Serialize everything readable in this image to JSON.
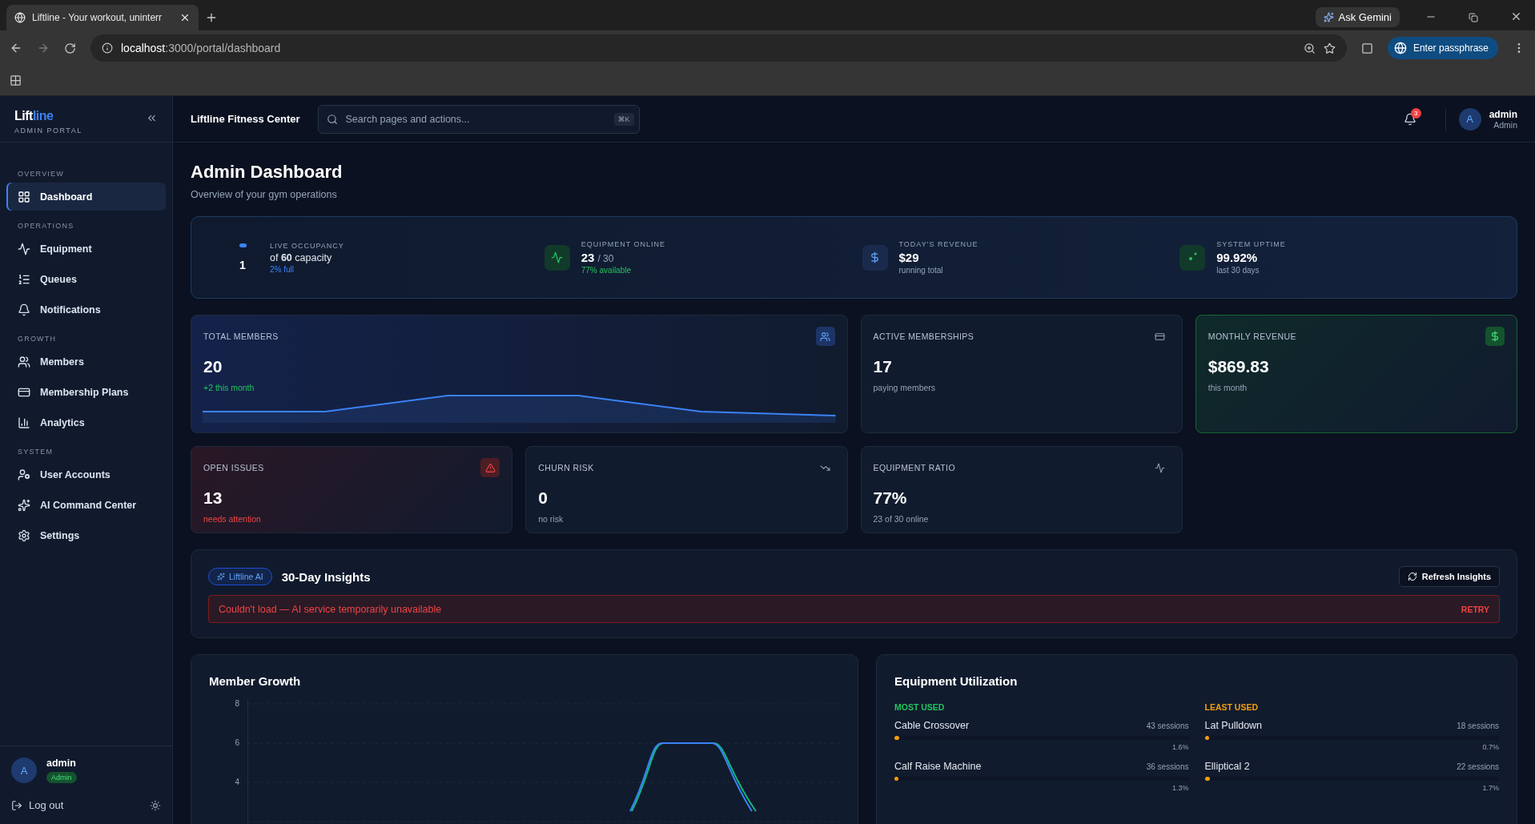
{
  "browser": {
    "tab_title": "Liftline - Your workout, uninterr",
    "url_host": "localhost",
    "url_path": ":3000/portal/dashboard",
    "gemini": "Ask Gemini",
    "profile": "Enter passphrase"
  },
  "sidebar": {
    "brand_main": "Lift",
    "brand_accent": "line",
    "subtitle": "ADMIN PORTAL",
    "sections": [
      {
        "label": "OVERVIEW",
        "items": [
          {
            "label": "Dashboard",
            "selected": true
          }
        ]
      },
      {
        "label": "OPERATIONS",
        "items": [
          {
            "label": "Equipment",
            "selected": false
          },
          {
            "label": "Queues",
            "selected": false
          },
          {
            "label": "Notifications",
            "selected": false
          }
        ]
      },
      {
        "label": "GROWTH",
        "items": [
          {
            "label": "Members",
            "selected": false
          },
          {
            "label": "Membership Plans",
            "selected": false
          },
          {
            "label": "Analytics",
            "selected": false
          }
        ]
      },
      {
        "label": "SYSTEM",
        "items": [
          {
            "label": "User Accounts",
            "selected": false
          },
          {
            "label": "AI Command Center",
            "selected": false
          },
          {
            "label": "Settings",
            "selected": false
          }
        ]
      }
    ],
    "user": {
      "avatar": "A",
      "name": "admin",
      "role": "Admin"
    },
    "logout": "Log out"
  },
  "header": {
    "org": "Liftline Fitness Center",
    "search_placeholder": "Search pages and actions...",
    "shortcut": "⌘K",
    "notifications": "3",
    "avatar": "A",
    "user": "admin",
    "role": "Admin"
  },
  "page": {
    "title": "Admin Dashboard",
    "subtitle": "Overview of your gym operations"
  },
  "live_strip": [
    {
      "kind": "occupancy",
      "label": "LIVE OCCUPANCY",
      "value": "1",
      "text": "of **60** capacity",
      "sub": "2% full"
    },
    {
      "kind": "equipment",
      "label": "EQUIPMENT ONLINE",
      "value": "23",
      "suffix": "/ 30",
      "sub": "77% available"
    },
    {
      "kind": "revenue",
      "label": "TODAY'S REVENUE",
      "value": "$29",
      "sub": "running total"
    },
    {
      "kind": "uptime",
      "label": "SYSTEM UPTIME",
      "value": "99.92%",
      "sub": "last 30 days"
    }
  ],
  "stat_cards": [
    {
      "kind": "trend",
      "label": "TOTAL MEMBERS",
      "value": "20",
      "sub": "+2 this month",
      "color": "#22c55e"
    },
    {
      "kind": "plain",
      "label": "ACTIVE MEMBERSHIPS",
      "value": "17",
      "sub": "paying members",
      "color": "#94a3b8"
    },
    {
      "kind": "highlight",
      "label": "MONTHLY REVENUE",
      "value": "$869.83",
      "sub": "this month",
      "color": "#94a3b8"
    },
    {
      "kind": "alert",
      "label": "OPEN ISSUES",
      "value": "13",
      "sub": "needs attention",
      "color": "#ef4444"
    },
    {
      "kind": "churn",
      "label": "CHURN RISK",
      "value": "0",
      "sub": "no risk",
      "color": "#94a3b8"
    },
    {
      "kind": "ratio",
      "label": "EQUIPMENT RATIO",
      "value": "77%",
      "sub": "23 of 30 online",
      "color": "#94a3b8"
    }
  ],
  "insights": {
    "badge": "Liftline AI",
    "title": "30-Day Insights",
    "refresh": "Refresh Insights",
    "error": "Couldn't load — AI service temporarily unavailable",
    "retry": "RETRY"
  },
  "member_growth": {
    "title": "Member Growth",
    "y_ticks": [
      "8",
      "6",
      "4"
    ]
  },
  "equipment_utilization": {
    "title": "Equipment Utilization",
    "groups": [
      {
        "heading": "MOST USED",
        "color": "#22c55e",
        "items": [
          {
            "name": "Cable Crossover",
            "sessions": "43 sessions",
            "level": 0.016,
            "percent": "1.6%"
          },
          {
            "name": "Calf Raise Machine",
            "sessions": "36 sessions",
            "level": 0.013,
            "percent": "1.3%"
          }
        ]
      },
      {
        "heading": "LEAST USED",
        "color": "#f59e0b",
        "items": [
          {
            "name": "Lat Pulldown",
            "sessions": "18 sessions",
            "level": 0.007,
            "percent": "0.7%"
          },
          {
            "name": "Elliptical 2",
            "sessions": "22 sessions",
            "level": 0.017,
            "percent": "1.7%"
          }
        ]
      }
    ]
  }
}
